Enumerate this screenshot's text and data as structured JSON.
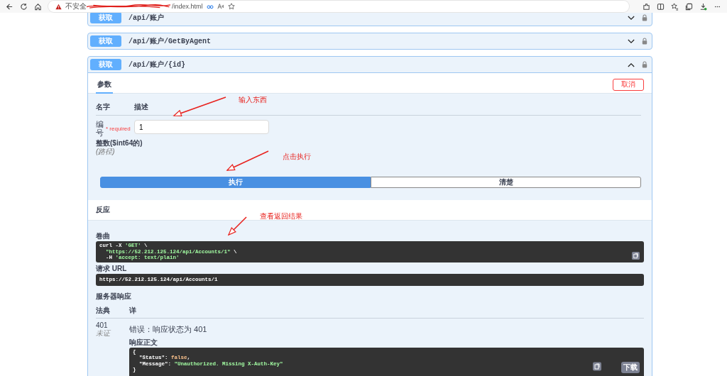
{
  "browser": {
    "security_label": "不安全",
    "url_tail": "/index.html"
  },
  "operations": [
    {
      "method": "获取",
      "path": "/api/账户",
      "expanded": false
    },
    {
      "method": "获取",
      "path": "/api/账户/GetByAgent",
      "expanded": false
    },
    {
      "method": "获取",
      "path": "/api/账户/{id}",
      "expanded": true
    }
  ],
  "panel": {
    "tabs": [
      {
        "label": "参数",
        "selected": true
      }
    ],
    "cancel_button": "取消",
    "columns": [
      "名字",
      "描述"
    ],
    "parameter": {
      "name": "编号",
      "required": "* required",
      "type": "整数($int64的)",
      "location": "(路径)",
      "value": "1"
    },
    "execute_button": "执行",
    "clear_button": "清楚",
    "responses_title": "反应",
    "curl_label": "卷曲",
    "curl_lines": [
      [
        {
          "text": "curl -X ",
          "kind": "plain"
        },
        {
          "text": "'GET'",
          "kind": "string"
        },
        {
          "text": " \\",
          "kind": "plain"
        }
      ],
      [
        {
          "text": "  \"https://52.212.125.124/api/Accounts/1\"",
          "kind": "string"
        },
        {
          "text": " \\",
          "kind": "plain"
        }
      ],
      [
        {
          "text": "  -H ",
          "kind": "plain"
        },
        {
          "text": "'accept: text/plain'",
          "kind": "string"
        }
      ]
    ],
    "request_url_label": "请求 URL",
    "request_url": "https://52.212.125.124/api/Accounts/1",
    "server_response_label": "服务器响应",
    "response_columns": [
      "法典",
      "详"
    ],
    "response": {
      "code": "401",
      "note": "未证",
      "error": "错误：响应状态为 401",
      "body_label": "响应正文",
      "body_lines": [
        [
          {
            "text": "{",
            "kind": "plain"
          }
        ],
        [
          {
            "text": "  \"Status\"",
            "kind": "plain"
          },
          {
            "text": ": ",
            "kind": "plain"
          },
          {
            "text": "false",
            "kind": "keyword"
          },
          {
            "text": ",",
            "kind": "plain"
          }
        ],
        [
          {
            "text": "  \"Message\"",
            "kind": "plain"
          },
          {
            "text": ": ",
            "kind": "plain"
          },
          {
            "text": "\"Unauthorized. Missing X-Auth-Key\"",
            "kind": "string"
          }
        ],
        [
          {
            "text": "}",
            "kind": "plain"
          }
        ]
      ],
      "download_button": "下载"
    }
  },
  "annotations": [
    {
      "text": "输入东西"
    },
    {
      "text": "点击执行"
    },
    {
      "text": "查看返回结果"
    }
  ]
}
